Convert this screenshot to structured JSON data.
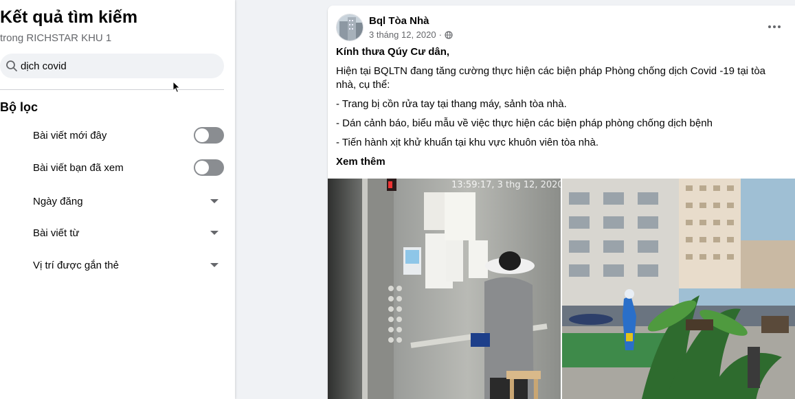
{
  "sidebar": {
    "title": "Kết quả tìm kiếm",
    "subtitle": "trong RICHSTAR KHU 1",
    "search": {
      "value": "dịch covid",
      "icon": "search-icon"
    },
    "filters_heading": "Bộ lọc",
    "filters": [
      {
        "label": "Bài viết mới đây",
        "control": "toggle",
        "state": "off"
      },
      {
        "label": "Bài viết bạn đã xem",
        "control": "toggle",
        "state": "off"
      },
      {
        "label": "Ngày đăng",
        "control": "dropdown"
      },
      {
        "label": "Bài viết từ",
        "control": "dropdown"
      },
      {
        "label": "Vị trí được gắn thẻ",
        "control": "dropdown"
      }
    ]
  },
  "post": {
    "author": "Bql Tòa Nhà",
    "date": "3 tháng 12, 2020",
    "separator": "·",
    "privacy_icon": "globe-icon",
    "greeting": "Kính thưa Qúy Cư dân,",
    "paragraphs": [
      "Hiện tại BQLTN đang tăng cường thực hiện các biện pháp Phòng chống dịch Covid -19 tại tòa nhà, cụ thể:",
      "- Trang bị cồn rửa tay tại thang máy, sảnh tòa nhà.",
      "- Dán cảnh báo, biểu mẫu về việc thực hiện các biện pháp phòng chống dịch bệnh",
      "- Tiến hành xịt khử khuẩn tại khu vực khuôn viên tòa nhà."
    ],
    "see_more": "Xem thêm",
    "photo_timestamp": "13:59:17, 3 thg 12, 2020"
  },
  "colors": {
    "background": "#f0f2f5",
    "text_primary": "#050505",
    "text_secondary": "#65676b",
    "toggle_off": "#8a8d91"
  }
}
